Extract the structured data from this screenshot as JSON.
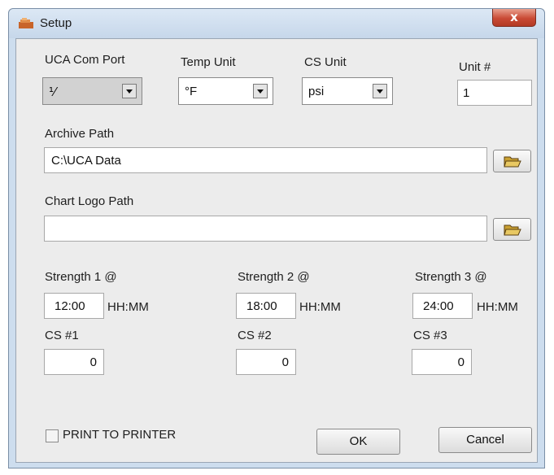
{
  "window": {
    "title": "Setup",
    "close_label": "x"
  },
  "com_port": {
    "label": "UCA Com Port",
    "value": "⅟"
  },
  "temp_unit": {
    "label": "Temp Unit",
    "value": "°F"
  },
  "cs_unit": {
    "label": "CS Unit",
    "value": "psi"
  },
  "unit_number": {
    "label": "Unit #",
    "value": "1"
  },
  "archive_path": {
    "label": "Archive Path",
    "value": "C:\\UCA Data"
  },
  "chart_logo_path": {
    "label": "Chart Logo Path",
    "value": ""
  },
  "strengths": [
    {
      "label": "Strength 1 @",
      "time": "12:00",
      "unit": "HH:MM",
      "cs_label": "CS #1",
      "cs_value": "0"
    },
    {
      "label": "Strength 2 @",
      "time": "18:00",
      "unit": "HH:MM",
      "cs_label": "CS #2",
      "cs_value": "0"
    },
    {
      "label": "Strength 3 @",
      "time": "24:00",
      "unit": "HH:MM",
      "cs_label": "CS #3",
      "cs_value": "0"
    }
  ],
  "print_to_printer": {
    "label": "PRINT TO PRINTER",
    "checked": false
  },
  "buttons": {
    "ok": "OK",
    "cancel": "Cancel"
  },
  "icons": {
    "folder": "folder-open-icon",
    "app": "app-icon",
    "dropdown": "chevron-down-icon"
  },
  "colors": {
    "close_button": "#c94a35",
    "folder": "#e8c862"
  }
}
